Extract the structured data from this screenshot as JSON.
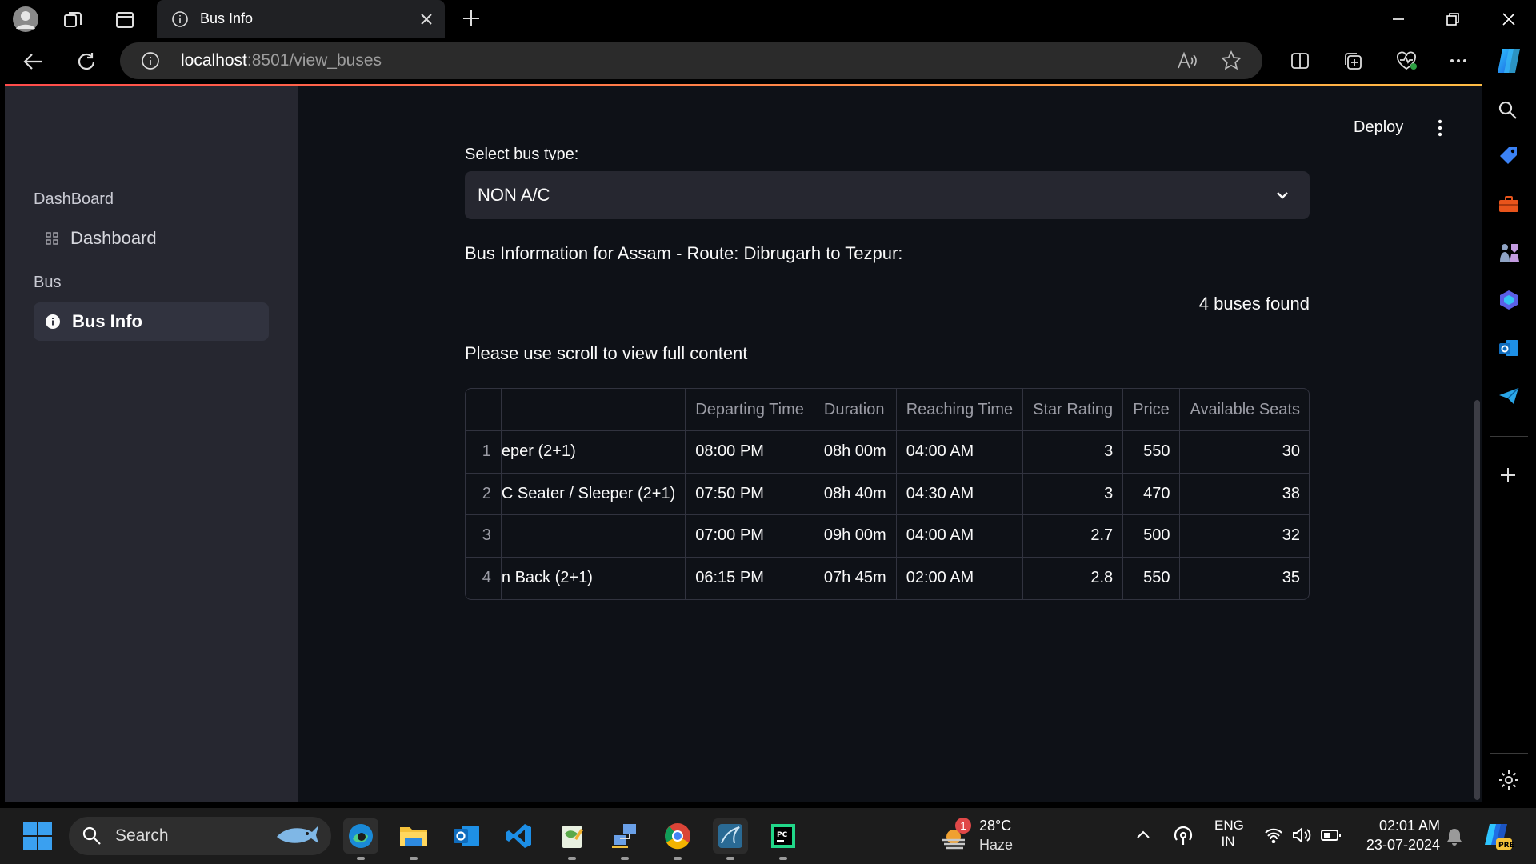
{
  "browser": {
    "tab_title": "Bus Info",
    "url_host": "localhost",
    "url_path": ":8501/view_buses"
  },
  "app": {
    "deploy_label": "Deploy",
    "sidebar": {
      "sections": [
        {
          "title": "DashBoard",
          "item": "Dashboard"
        },
        {
          "title": "Bus",
          "item": "Bus Info"
        }
      ]
    },
    "select_label": "Select bus type:",
    "select_value": "NON A/C",
    "info_text": "Bus Information for Assam - Route: Dibrugarh to Tezpur:",
    "found_text": "4 buses found",
    "scroll_text": "Please use scroll to view full content",
    "table": {
      "columns": [
        "",
        "",
        "Departing Time",
        "Duration",
        "Reaching Time",
        "Star Rating",
        "Price",
        "Available Seats"
      ],
      "rows": [
        [
          "1",
          "eper (2+1)",
          "08:00 PM",
          "08h 00m",
          "04:00 AM",
          "3",
          "550",
          "30"
        ],
        [
          "2",
          "C Seater / Sleeper (2+1)",
          "07:50 PM",
          "08h 40m",
          "04:30 AM",
          "3",
          "470",
          "38"
        ],
        [
          "3",
          "",
          "07:00 PM",
          "09h 00m",
          "04:00 AM",
          "2.7",
          "500",
          "32"
        ],
        [
          "4",
          "n Back (2+1)",
          "06:15 PM",
          "07h 45m",
          "02:00 AM",
          "2.8",
          "550",
          "35"
        ]
      ]
    }
  },
  "taskbar": {
    "search_placeholder": "Search",
    "weather_temp": "28°C",
    "weather_desc": "Haze",
    "weather_badge": "1",
    "lang_top": "ENG",
    "lang_bottom": "IN",
    "time": "02:01 AM",
    "date": "23-07-2024"
  },
  "colors": {
    "accent_red": "#ff4b4b",
    "sidebar_bg": "#262730",
    "main_bg": "#0e1117"
  }
}
